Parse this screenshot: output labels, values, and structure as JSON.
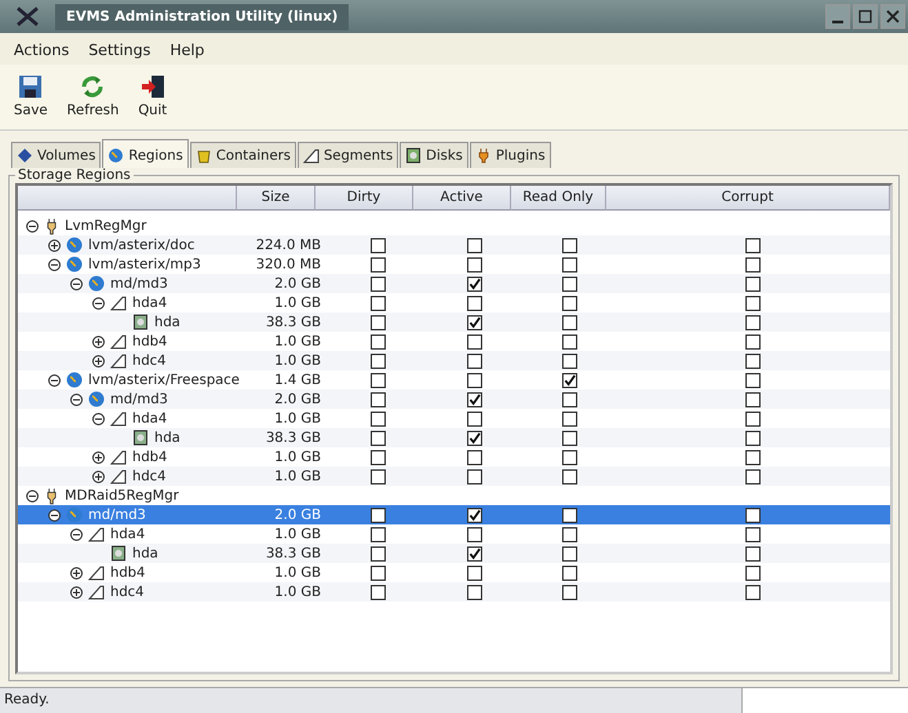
{
  "window": {
    "title": "EVMS Administration Utility (linux)"
  },
  "menu": [
    "Actions",
    "Settings",
    "Help"
  ],
  "toolbar": [
    {
      "label": "Save",
      "kind": "save"
    },
    {
      "label": "Refresh",
      "kind": "refresh"
    },
    {
      "label": "Quit",
      "kind": "quit"
    }
  ],
  "tabs": [
    {
      "label": "Volumes",
      "kind": "volume",
      "selected": false
    },
    {
      "label": "Regions",
      "kind": "region",
      "selected": true
    },
    {
      "label": "Containers",
      "kind": "container",
      "selected": false
    },
    {
      "label": "Segments",
      "kind": "segment",
      "selected": false
    },
    {
      "label": "Disks",
      "kind": "disk",
      "selected": false
    },
    {
      "label": "Plugins",
      "kind": "plugin",
      "selected": false
    }
  ],
  "storage_regions": {
    "title": "Storage Regions",
    "columns": [
      "Size",
      "Dirty",
      "Active",
      "Read Only",
      "Corrupt"
    ],
    "tree": [
      {
        "name": "LvmRegMgr",
        "kind": "manager",
        "expanded": true,
        "selected": false,
        "children": [
          {
            "name": "lvm/asterix/doc",
            "kind": "region",
            "size": "224.0 MB",
            "dirty": false,
            "active": false,
            "read_only": false,
            "corrupt": false,
            "expanded": false,
            "selected": false
          },
          {
            "name": "lvm/asterix/mp3",
            "kind": "region",
            "size": "320.0 MB",
            "dirty": false,
            "active": false,
            "read_only": false,
            "corrupt": false,
            "expanded": true,
            "selected": false,
            "children": [
              {
                "name": "md/md3",
                "kind": "region",
                "size": "2.0 GB",
                "dirty": false,
                "active": true,
                "read_only": false,
                "corrupt": false,
                "expanded": true,
                "selected": false,
                "children": [
                  {
                    "name": "hda4",
                    "kind": "segment",
                    "size": "1.0 GB",
                    "dirty": false,
                    "active": false,
                    "read_only": false,
                    "corrupt": false,
                    "expanded": true,
                    "selected": false,
                    "children": [
                      {
                        "name": "hda",
                        "kind": "disk",
                        "size": "38.3 GB",
                        "dirty": false,
                        "active": true,
                        "read_only": false,
                        "corrupt": false,
                        "selected": false
                      }
                    ]
                  },
                  {
                    "name": "hdb4",
                    "kind": "segment",
                    "size": "1.0 GB",
                    "dirty": false,
                    "active": false,
                    "read_only": false,
                    "corrupt": false,
                    "expanded": false,
                    "selected": false
                  },
                  {
                    "name": "hdc4",
                    "kind": "segment",
                    "size": "1.0 GB",
                    "dirty": false,
                    "active": false,
                    "read_only": false,
                    "corrupt": false,
                    "expanded": false,
                    "selected": false
                  }
                ]
              }
            ]
          },
          {
            "name": "lvm/asterix/Freespace",
            "kind": "region",
            "size": "1.4 GB",
            "dirty": false,
            "active": false,
            "read_only": true,
            "corrupt": false,
            "expanded": true,
            "selected": false,
            "children": [
              {
                "name": "md/md3",
                "kind": "region",
                "size": "2.0 GB",
                "dirty": false,
                "active": true,
                "read_only": false,
                "corrupt": false,
                "expanded": true,
                "selected": false,
                "children": [
                  {
                    "name": "hda4",
                    "kind": "segment",
                    "size": "1.0 GB",
                    "dirty": false,
                    "active": false,
                    "read_only": false,
                    "corrupt": false,
                    "expanded": true,
                    "selected": false,
                    "children": [
                      {
                        "name": "hda",
                        "kind": "disk",
                        "size": "38.3 GB",
                        "dirty": false,
                        "active": true,
                        "read_only": false,
                        "corrupt": false,
                        "selected": false
                      }
                    ]
                  },
                  {
                    "name": "hdb4",
                    "kind": "segment",
                    "size": "1.0 GB",
                    "dirty": false,
                    "active": false,
                    "read_only": false,
                    "corrupt": false,
                    "expanded": false,
                    "selected": false
                  },
                  {
                    "name": "hdc4",
                    "kind": "segment",
                    "size": "1.0 GB",
                    "dirty": false,
                    "active": false,
                    "read_only": false,
                    "corrupt": false,
                    "expanded": false,
                    "selected": false
                  }
                ]
              }
            ]
          }
        ]
      },
      {
        "name": "MDRaid5RegMgr",
        "kind": "manager",
        "expanded": true,
        "selected": false,
        "children": [
          {
            "name": "md/md3",
            "kind": "region",
            "size": "2.0 GB",
            "dirty": false,
            "active": true,
            "read_only": false,
            "corrupt": false,
            "expanded": true,
            "selected": true,
            "children": [
              {
                "name": "hda4",
                "kind": "segment",
                "size": "1.0 GB",
                "dirty": false,
                "active": false,
                "read_only": false,
                "corrupt": false,
                "expanded": true,
                "selected": false,
                "children": [
                  {
                    "name": "hda",
                    "kind": "disk",
                    "size": "38.3 GB",
                    "dirty": false,
                    "active": true,
                    "read_only": false,
                    "corrupt": false,
                    "selected": false
                  }
                ]
              },
              {
                "name": "hdb4",
                "kind": "segment",
                "size": "1.0 GB",
                "dirty": false,
                "active": false,
                "read_only": false,
                "corrupt": false,
                "expanded": false,
                "selected": false
              },
              {
                "name": "hdc4",
                "kind": "segment",
                "size": "1.0 GB",
                "dirty": false,
                "active": false,
                "read_only": false,
                "corrupt": false,
                "expanded": false,
                "selected": false
              }
            ]
          }
        ]
      }
    ]
  },
  "status_bar": {
    "text": "Ready."
  }
}
